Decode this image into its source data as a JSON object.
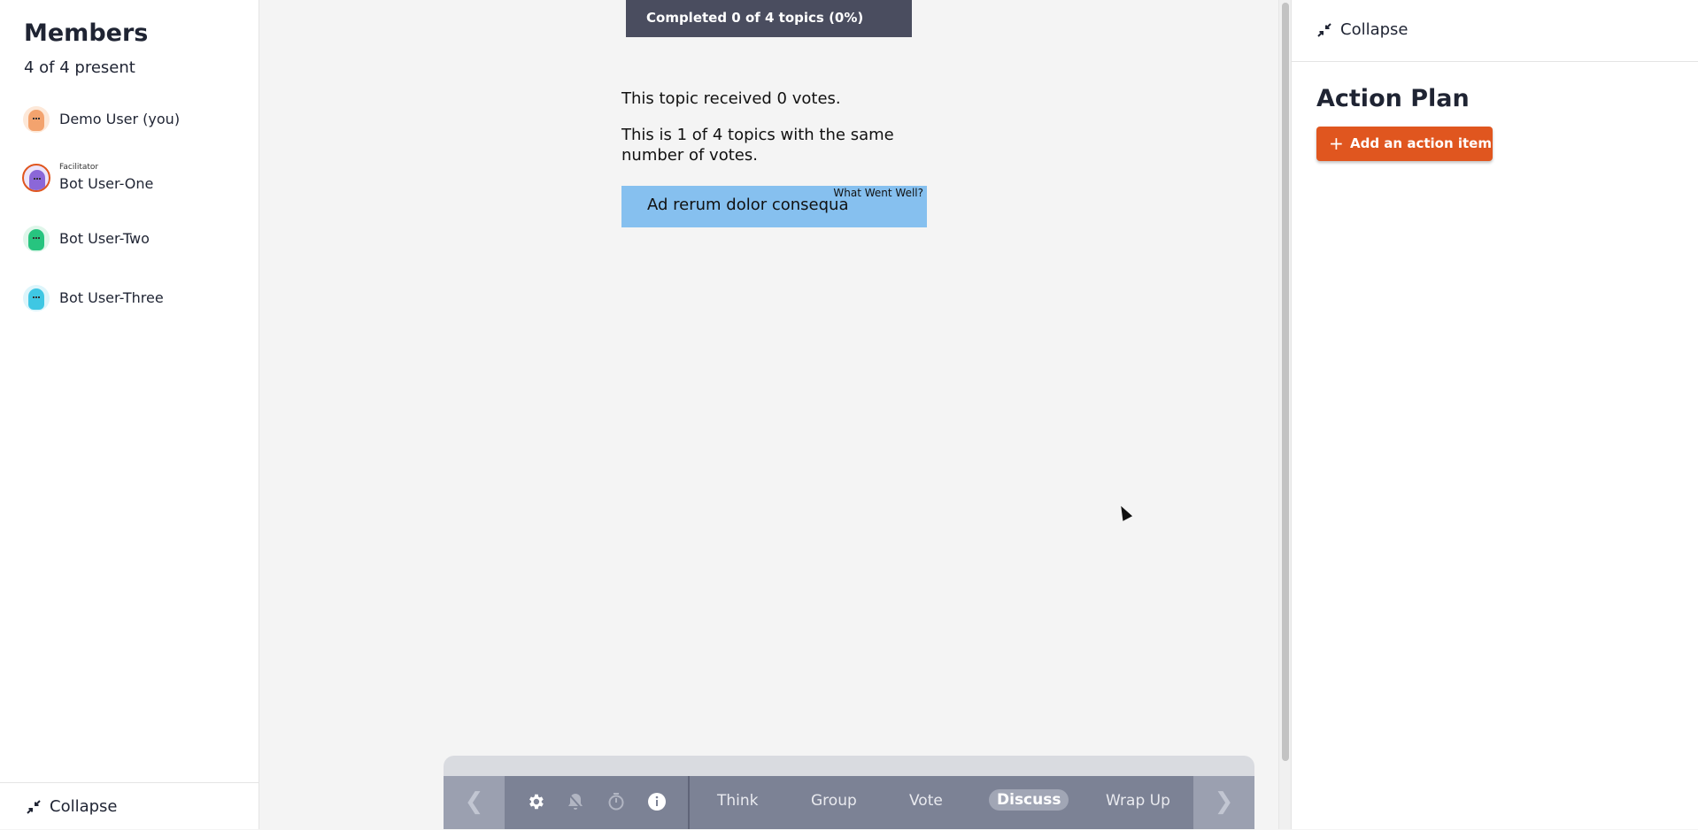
{
  "members_panel": {
    "title": "Members",
    "present": "4 of 4 present",
    "members": [
      {
        "name": "Demo User (you)",
        "role": "",
        "color": "#f3a36e"
      },
      {
        "name": "Bot User-One",
        "role": "Facilitator",
        "color": "#8b67d8"
      },
      {
        "name": "Bot User-Two",
        "role": "",
        "color": "#27c47f"
      },
      {
        "name": "Bot User-Three",
        "role": "",
        "color": "#3fc7e3"
      }
    ],
    "collapse_label": "Collapse"
  },
  "main": {
    "progress": "Completed 0 of 4 topics (0%)",
    "votes_message": "This topic received 0 votes.",
    "tie_message_line1": "This is 1 of 4 topics with the same",
    "tie_message_line2": "number of votes.",
    "card": {
      "text": "Ad rerum dolor consequa",
      "column": "What Went Well?"
    }
  },
  "toolbar": {
    "prev_icon": "chevron-left-icon",
    "next_icon": "chevron-right-icon",
    "tools": [
      "gear-icon",
      "bell-icon",
      "timer-icon",
      "info-icon"
    ],
    "phases": [
      "Think",
      "Group",
      "Vote",
      "Discuss",
      "Wrap Up"
    ],
    "active_phase": "Discuss"
  },
  "action_panel": {
    "collapse_label": "Collapse",
    "title": "Action Plan",
    "add_button": "Add an action item",
    "accent": "#e0561f"
  }
}
